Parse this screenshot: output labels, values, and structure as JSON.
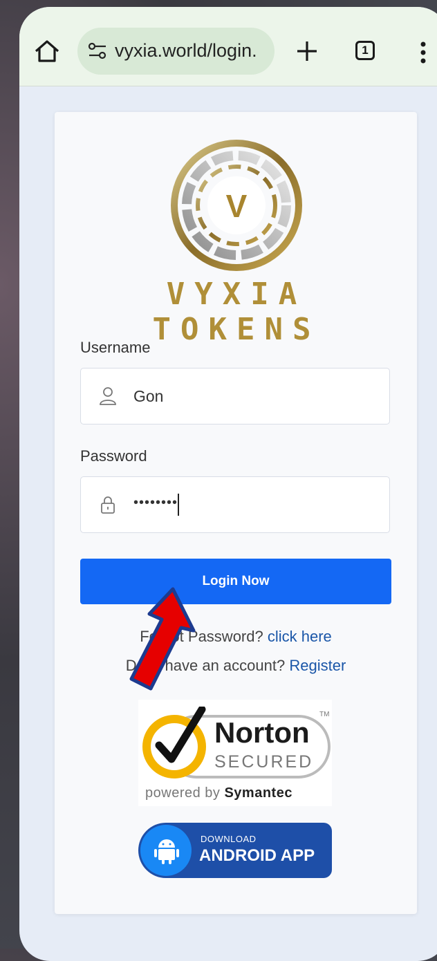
{
  "browser": {
    "url_display": "vyxia.world/login.",
    "tab_count": "1"
  },
  "brand": {
    "logo_letter": "V",
    "name": "VYXIA TOKENS"
  },
  "form": {
    "username_label": "Username",
    "username_value": "Gon",
    "password_label": "Password",
    "password_value": "••••••••",
    "submit_label": "Login Now"
  },
  "links": {
    "forgot_prefix": "Forgot Password?",
    "forgot_link": "click here",
    "register_prefix": "Don't have an account?",
    "register_link": "Register"
  },
  "norton": {
    "word": "Norton",
    "secured": "SECURED",
    "tm": "TM",
    "powered_by": "powered by",
    "company": "Symantec"
  },
  "android_badge": {
    "small": "DOWNLOAD",
    "big": "ANDROID APP"
  },
  "colors": {
    "primary_button": "#1468f4",
    "link": "#1a56a8",
    "brand_gold": "#b08f38",
    "annotation_arrow": "#e60000"
  }
}
